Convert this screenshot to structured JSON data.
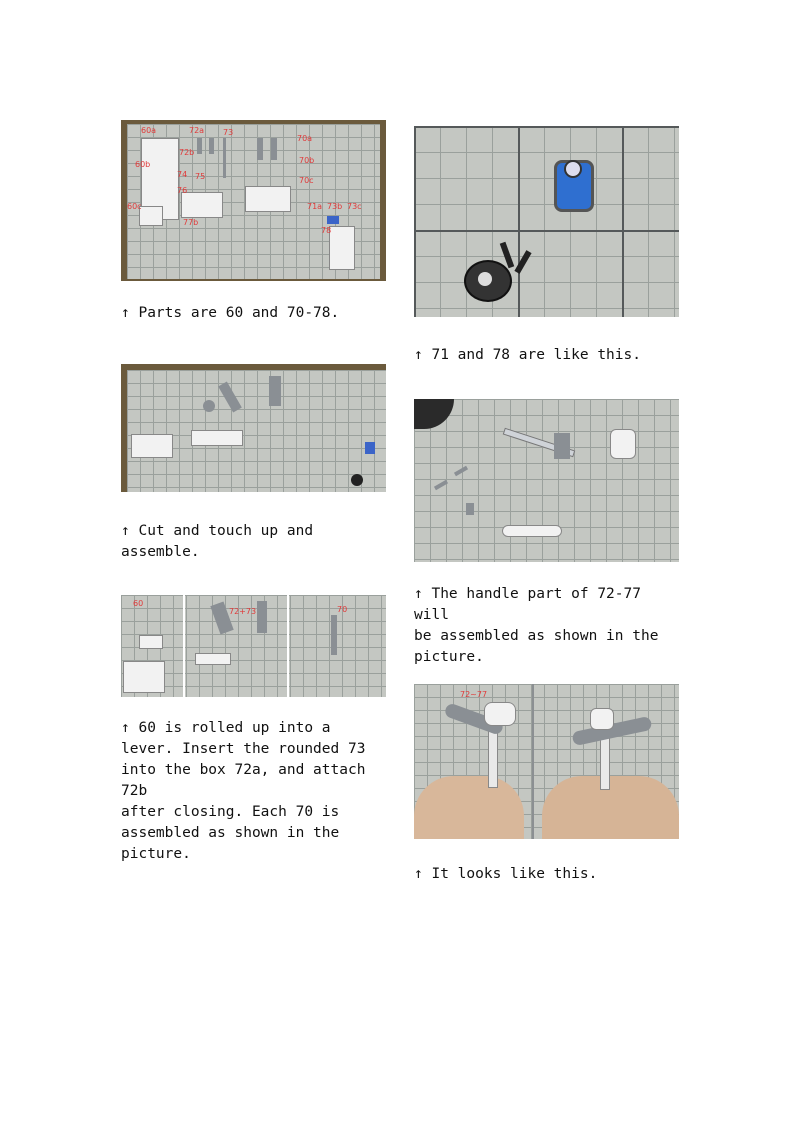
{
  "left_column": {
    "photo1": {
      "labels": [
        "60a",
        "72a",
        "72b",
        "73",
        "70a",
        "60b",
        "70b",
        "74",
        "75",
        "70c",
        "76",
        "60c",
        "71a",
        "73b",
        "73c",
        "77b",
        "78"
      ]
    },
    "caption1": "↑ Parts are 60 and 70-78.",
    "caption2": "↑ Cut and touch up and\nassemble.",
    "photo3": {
      "labels": [
        "60",
        "72+73",
        "70"
      ]
    },
    "caption3": "↑ 60 is rolled up into a\nlever. Insert the rounded 73\ninto the box 72a, and attach 72b\nafter closing. Each 70 is\nassembled as shown in the\npicture."
  },
  "right_column": {
    "caption1": "↑ 71 and 78 are like this.",
    "caption2": "↑ The handle part of 72-77 will\nbe assembled as shown in the\npicture.",
    "photo4": {
      "labels": [
        "72~77"
      ]
    },
    "caption3": "↑ It looks like this."
  }
}
